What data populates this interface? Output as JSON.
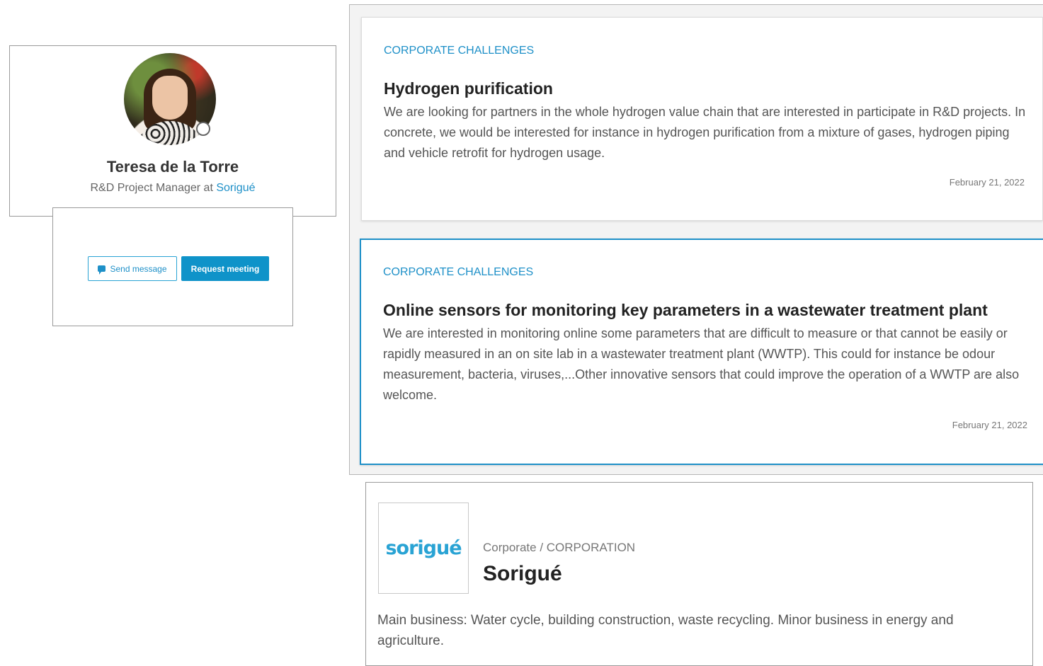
{
  "profile": {
    "name": "Teresa de la Torre",
    "role_prefix": "R&D Project Manager at",
    "company_link": "Sorigué"
  },
  "actions": {
    "send_message": "Send message",
    "request_meeting": "Request meeting"
  },
  "challenges": [
    {
      "tag": "CORPORATE CHALLENGES",
      "title": "Hydrogen purification",
      "description": "We are looking for partners in the whole hydrogen value chain that are interested in participate in R&D projects. In concrete, we would be interested for instance in hydrogen purification from a mixture of gases, hydrogen piping and vehicle retrofit for hydrogen usage.",
      "date": "February 21, 2022"
    },
    {
      "tag": "CORPORATE CHALLENGES",
      "title": "Online sensors for monitoring key parameters in a wastewater treatment plant",
      "description": "We are interested in monitoring online some parameters that are difficult to measure or that cannot be easily or rapidly measured in an on site lab in a wastewater treatment plant (WWTP). This could for instance be odour measurement, bacteria, viruses,...Other innovative sensors that could improve the operation of a WWTP are also welcome.",
      "date": "February 21, 2022"
    }
  ],
  "company": {
    "logo_text": "sorigué",
    "type": "Corporate / CORPORATION",
    "name": "Sorigué",
    "description": "Main business: Water cycle, building construction, waste recycling. Minor business in energy and agriculture."
  },
  "colors": {
    "accent": "#1e90c8",
    "button_primary": "#0f93c9"
  },
  "icons": [
    "message-icon",
    "status-icon"
  ]
}
